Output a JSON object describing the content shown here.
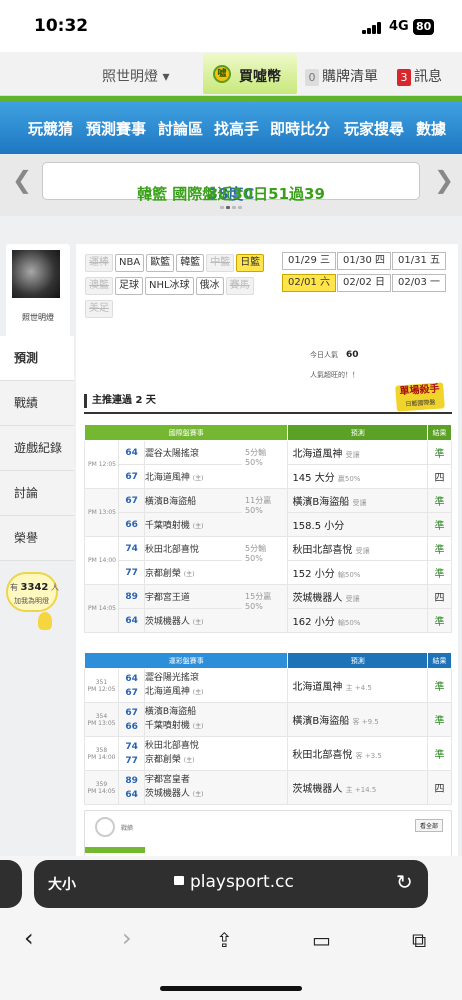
{
  "status": {
    "time": "10:32",
    "network": "4G",
    "battery": "80"
  },
  "topbar": {
    "lighten": "照世明燈 ▾",
    "coin": "買噓幣",
    "cart_count": "0",
    "cart": "購牌清單",
    "msg_count": "3",
    "msg": "訊息"
  },
  "nav": [
    "玩競猜",
    "預測賽事",
    "討論區",
    "找高手",
    "即時比分",
    "玩家搜尋",
    "數據"
  ],
  "marquee": {
    "text_part1": "38度C",
    "text_part2": "韓籃 國際盤近30日51過39"
  },
  "profile": {
    "name": "照世明燈"
  },
  "sidemenu": [
    "預測",
    "戰績",
    "遊戲紀錄",
    "討論",
    "榮譽"
  ],
  "hits": {
    "prefix": "有",
    "count": "3342",
    "unit": "人",
    "label": "加我為明燈"
  },
  "leagues": [
    {
      "label": "運棒",
      "state": "disabled"
    },
    {
      "label": "NBA",
      "state": "normal"
    },
    {
      "label": "歐籃",
      "state": "normal"
    },
    {
      "label": "韓籃",
      "state": "normal"
    },
    {
      "label": "中籃",
      "state": "disabled"
    },
    {
      "label": "日籃",
      "state": "selected"
    },
    {
      "label": "澳籃",
      "state": "disabled"
    },
    {
      "label": "足球",
      "state": "normal"
    },
    {
      "label": "NHL冰球",
      "state": "normal"
    },
    {
      "label": "俄冰",
      "state": "normal"
    },
    {
      "label": "賽馬",
      "state": "disabled"
    },
    {
      "label": "美足",
      "state": "disabled"
    }
  ],
  "dates": [
    {
      "label": "01/29 三",
      "selected": false
    },
    {
      "label": "01/30 四",
      "selected": false
    },
    {
      "label": "01/31 五",
      "selected": false
    },
    {
      "label": "02/01 六",
      "selected": true
    },
    {
      "label": "02/02 日",
      "selected": false
    },
    {
      "label": "02/03 一",
      "selected": false
    }
  ],
  "popularity": {
    "label": "今日人氣",
    "value": "60",
    "sub": "人氣超旺的！！"
  },
  "sniper": {
    "title": "單場殺手",
    "sub": "日籃國際盤"
  },
  "streak": "主推連過 2 天",
  "intl": {
    "headers": [
      "國際盤賽事",
      "預測",
      "結果"
    ],
    "games": [
      {
        "time": "PM 12:05",
        "home_no": "64",
        "home": "澀谷太陽搖滾",
        "away_no": "67",
        "away": "北海道風神",
        "away_tag": "(主)",
        "line1": "5分輸",
        "line2": "50%",
        "picks": [
          {
            "text": "北海道風神",
            "note": "受讓",
            "res": "準",
            "win": true
          },
          {
            "text": "145 大分",
            "note": "贏50%",
            "res": "四",
            "win": false
          }
        ]
      },
      {
        "time": "PM 13:05",
        "home_no": "67",
        "home": "橫濱B海盜船",
        "away_no": "66",
        "away": "千葉噴射機",
        "away_tag": "(主)",
        "line1": "11分贏",
        "line2": "50%",
        "picks": [
          {
            "text": "橫濱B海盜船",
            "note": "受讓",
            "res": "準",
            "win": true
          },
          {
            "text": "158.5 小分",
            "note": "",
            "res": "準",
            "win": true
          }
        ]
      },
      {
        "time": "PM 14:00",
        "home_no": "74",
        "home": "秋田北部喜悅",
        "away_no": "77",
        "away": "京都創榮",
        "away_tag": "(主)",
        "line1": "5分輸",
        "line2": "50%",
        "picks": [
          {
            "text": "秋田北部喜悅",
            "note": "受讓",
            "res": "準",
            "win": true
          },
          {
            "text": "152 小分",
            "note": "輸50%",
            "res": "準",
            "win": true
          }
        ]
      },
      {
        "time": "PM 14:05",
        "home_no": "89",
        "home": "宇都宮王道",
        "away_no": "64",
        "away": "茨城機器人",
        "away_tag": "(主)",
        "line1": "15分贏",
        "line2": "50%",
        "picks": [
          {
            "text": "茨城機器人",
            "note": "受讓",
            "res": "四",
            "win": false
          },
          {
            "text": "162 小分",
            "note": "輸50%",
            "res": "準",
            "win": true
          }
        ]
      }
    ]
  },
  "lottery": {
    "headers": [
      "運彩盤賽事",
      "預測",
      "結果"
    ],
    "games": [
      {
        "sn": "351",
        "time": "PM 12:05",
        "home_no": "64",
        "home": "澀谷陽光搖滾",
        "away_no": "67",
        "away": "北海道風神",
        "away_tag": "(主)",
        "pick": "北海道風神",
        "note": "主 +4.5",
        "res": "準",
        "win": true
      },
      {
        "sn": "354",
        "time": "PM 13:05",
        "home_no": "67",
        "home": "橫濱B海盜船",
        "away_no": "66",
        "away": "千葉噴射機",
        "away_tag": "(主)",
        "pick": "橫濱B海盜船",
        "note": "客 +9.5",
        "res": "準",
        "win": true
      },
      {
        "sn": "358",
        "time": "PM 14:00",
        "home_no": "74",
        "home": "秋田北部喜悅",
        "away_no": "77",
        "away": "京都創榮",
        "away_tag": "(主)",
        "pick": "秋田北部喜悅",
        "note": "客 +3.5",
        "res": "準",
        "win": true
      },
      {
        "sn": "359",
        "time": "PM 14:05",
        "home_no": "89",
        "home": "宇都宮皇者",
        "away_no": "64",
        "away": "茨城機器人",
        "away_tag": "(主)",
        "pick": "茨城機器人",
        "note": "主 +14.5",
        "res": "四",
        "win": false
      }
    ]
  },
  "stats": {
    "label": "戰績",
    "more": "看全部"
  },
  "browser": {
    "aa": "大小",
    "url": "playsport.cc"
  },
  "colors": {
    "nav_blue": "#2a86cf",
    "green": "#73b830",
    "win": "#2e8b23",
    "lottery_blue": "#2d8fd9"
  }
}
